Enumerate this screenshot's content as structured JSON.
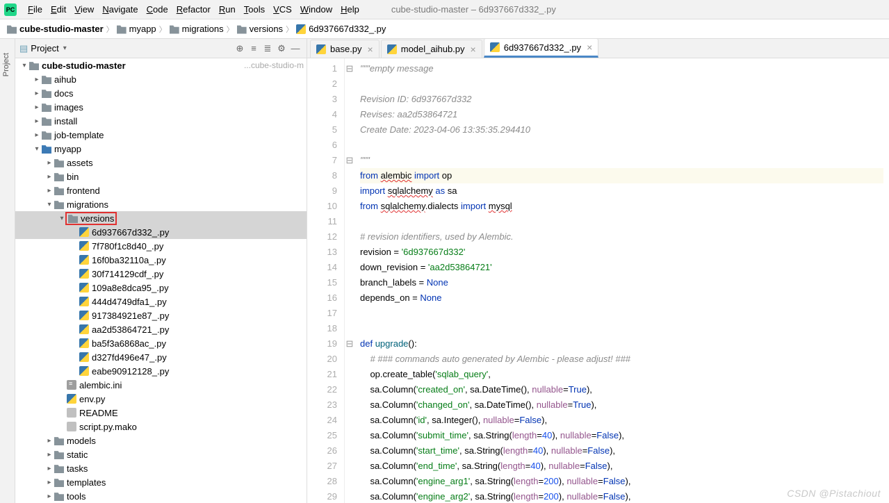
{
  "window_title": "cube-studio-master – 6d937667d332_.py",
  "menu": [
    "File",
    "Edit",
    "View",
    "Navigate",
    "Code",
    "Refactor",
    "Run",
    "Tools",
    "VCS",
    "Window",
    "Help"
  ],
  "breadcrumb": [
    "cube-studio-master",
    "myapp",
    "migrations",
    "versions",
    "6d937667d332_.py"
  ],
  "project": {
    "title": "Project",
    "root": "cube-studio-master",
    "root_hint": "...cube-studio-m",
    "items": [
      {
        "type": "dir",
        "name": "aihub",
        "depth": 1,
        "exp": false
      },
      {
        "type": "dir",
        "name": "docs",
        "depth": 1,
        "exp": false
      },
      {
        "type": "dir",
        "name": "images",
        "depth": 1,
        "exp": false
      },
      {
        "type": "dir",
        "name": "install",
        "depth": 1,
        "exp": false
      },
      {
        "type": "dir",
        "name": "job-template",
        "depth": 1,
        "exp": false
      },
      {
        "type": "dir-src",
        "name": "myapp",
        "depth": 1,
        "exp": true
      },
      {
        "type": "dir",
        "name": "assets",
        "depth": 2,
        "exp": false
      },
      {
        "type": "dir",
        "name": "bin",
        "depth": 2,
        "exp": false
      },
      {
        "type": "dir",
        "name": "frontend",
        "depth": 2,
        "exp": false
      },
      {
        "type": "dir",
        "name": "migrations",
        "depth": 2,
        "exp": true
      },
      {
        "type": "dir",
        "name": "versions",
        "depth": 3,
        "exp": true,
        "selected": true,
        "boxed": true
      },
      {
        "type": "py",
        "name": "6d937667d332_.py",
        "depth": 4,
        "selected": true
      },
      {
        "type": "py",
        "name": "7f780f1c8d40_.py",
        "depth": 4
      },
      {
        "type": "py",
        "name": "16f0ba32110a_.py",
        "depth": 4
      },
      {
        "type": "py",
        "name": "30f714129cdf_.py",
        "depth": 4
      },
      {
        "type": "py",
        "name": "109a8e8dca95_.py",
        "depth": 4
      },
      {
        "type": "py",
        "name": "444d4749dfa1_.py",
        "depth": 4
      },
      {
        "type": "py",
        "name": "917384921e87_.py",
        "depth": 4
      },
      {
        "type": "py",
        "name": "aa2d53864721_.py",
        "depth": 4
      },
      {
        "type": "py",
        "name": "ba5f3a6868ac_.py",
        "depth": 4
      },
      {
        "type": "py",
        "name": "d327fd496e47_.py",
        "depth": 4
      },
      {
        "type": "py",
        "name": "eabe90912128_.py",
        "depth": 4
      },
      {
        "type": "ini",
        "name": "alembic.ini",
        "depth": 3
      },
      {
        "type": "py",
        "name": "env.py",
        "depth": 3
      },
      {
        "type": "txt",
        "name": "README",
        "depth": 3
      },
      {
        "type": "txt",
        "name": "script.py.mako",
        "depth": 3
      },
      {
        "type": "dir",
        "name": "models",
        "depth": 2,
        "exp": false
      },
      {
        "type": "dir",
        "name": "static",
        "depth": 2,
        "exp": false
      },
      {
        "type": "dir",
        "name": "tasks",
        "depth": 2,
        "exp": false
      },
      {
        "type": "dir",
        "name": "templates",
        "depth": 2,
        "exp": false
      },
      {
        "type": "dir",
        "name": "tools",
        "depth": 2,
        "exp": false
      }
    ]
  },
  "tabs": [
    {
      "name": "base.py",
      "active": false
    },
    {
      "name": "model_aihub.py",
      "active": false
    },
    {
      "name": "6d937667d332_.py",
      "active": true
    }
  ],
  "code": {
    "lines": 29,
    "content": [
      {
        "n": 1,
        "t": "cmt",
        "txt": "\"\"\"empty message",
        "fold": "-"
      },
      {
        "n": 2,
        "t": "blank"
      },
      {
        "n": 3,
        "t": "cmt",
        "txt": "Revision ID: 6d937667d332"
      },
      {
        "n": 4,
        "t": "cmt",
        "txt": "Revises: aa2d53864721"
      },
      {
        "n": 5,
        "t": "cmt",
        "txt": "Create Date: 2023-04-06 13:35:35.294410"
      },
      {
        "n": 6,
        "t": "blank"
      },
      {
        "n": 7,
        "t": "cmt",
        "txt": "\"\"\"",
        "fold": "-"
      },
      {
        "n": 8,
        "t": "code",
        "hl": true,
        "html": "<span class='kw'>from</span> <span class='squig'>alembic</span> <span class='kw'>import</span> op"
      },
      {
        "n": 9,
        "t": "code",
        "html": "<span class='kw'>import</span> <span class='squig'>sqlalchemy</span> <span class='kw'>as</span> sa"
      },
      {
        "n": 10,
        "t": "code",
        "html": "<span class='kw'>from</span> <span class='squig'>sqlalchemy</span>.dialects <span class='kw'>import</span> <span class='squig'>mysql</span>"
      },
      {
        "n": 11,
        "t": "blank"
      },
      {
        "n": 12,
        "t": "cmt",
        "txt": "# revision identifiers, used by Alembic."
      },
      {
        "n": 13,
        "t": "code",
        "html": "revision = <span class='str'>'6d937667d332'</span>"
      },
      {
        "n": 14,
        "t": "code",
        "html": "down_revision = <span class='str'>'aa2d53864721'</span>"
      },
      {
        "n": 15,
        "t": "code",
        "html": "branch_labels = <span class='none'>None</span>"
      },
      {
        "n": 16,
        "t": "code",
        "html": "depends_on = <span class='none'>None</span>"
      },
      {
        "n": 17,
        "t": "blank"
      },
      {
        "n": 18,
        "t": "blank"
      },
      {
        "n": 19,
        "t": "code",
        "fold": "-",
        "html": "<span class='kw'>def</span> <span class='fn'>upgrade</span>():"
      },
      {
        "n": 20,
        "t": "cmt",
        "indent": 1,
        "txt": "# ### commands auto generated by Alembic - please adjust! ###"
      },
      {
        "n": 21,
        "t": "code",
        "indent": 1,
        "html": "op.create_table(<span class='str'>'sqlab_query'</span>,"
      },
      {
        "n": 22,
        "t": "code",
        "indent": 1,
        "html": "sa.Column(<span class='str'>'created_on'</span>, sa.DateTime(), <span class='self'>nullable</span>=<span class='none'>True</span>),"
      },
      {
        "n": 23,
        "t": "code",
        "indent": 1,
        "html": "sa.Column(<span class='str'>'changed_on'</span>, sa.DateTime(), <span class='self'>nullable</span>=<span class='none'>True</span>),"
      },
      {
        "n": 24,
        "t": "code",
        "indent": 1,
        "html": "sa.Column(<span class='str'>'id'</span>, sa.Integer(), <span class='self'>nullable</span>=<span class='none'>False</span>),"
      },
      {
        "n": 25,
        "t": "code",
        "indent": 1,
        "html": "sa.Column(<span class='str'>'submit_time'</span>, sa.String(<span class='self'>length</span>=<span class='num'>40</span>), <span class='self'>nullable</span>=<span class='none'>False</span>),"
      },
      {
        "n": 26,
        "t": "code",
        "indent": 1,
        "html": "sa.Column(<span class='str'>'start_time'</span>, sa.String(<span class='self'>length</span>=<span class='num'>40</span>), <span class='self'>nullable</span>=<span class='none'>False</span>),"
      },
      {
        "n": 27,
        "t": "code",
        "indent": 1,
        "html": "sa.Column(<span class='str'>'end_time'</span>, sa.String(<span class='self'>length</span>=<span class='num'>40</span>), <span class='self'>nullable</span>=<span class='none'>False</span>),"
      },
      {
        "n": 28,
        "t": "code",
        "indent": 1,
        "html": "sa.Column(<span class='str'>'engine_arg1'</span>, sa.String(<span class='self'>length</span>=<span class='num'>200</span>), <span class='self'>nullable</span>=<span class='none'>False</span>),"
      },
      {
        "n": 29,
        "t": "code",
        "indent": 1,
        "html": "sa.Column(<span class='str'>'engine_arg2'</span>, sa.String(<span class='self'>length</span>=<span class='num'>200</span>), <span class='self'>nullable</span>=<span class='none'>False</span>),"
      }
    ]
  },
  "watermark": "CSDN @Pistachiout"
}
